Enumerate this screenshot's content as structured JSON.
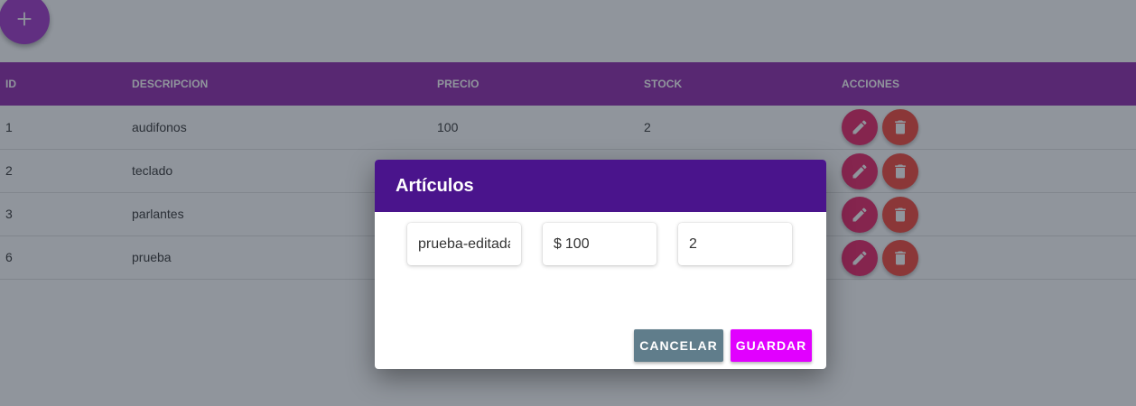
{
  "fab": {
    "icon": "plus-icon"
  },
  "table": {
    "headers": {
      "id": "ID",
      "descripcion": "DESCRIPCION",
      "precio": "PRECIO",
      "stock": "STOCK",
      "acciones": "ACCIONES"
    },
    "rows": [
      {
        "id": "1",
        "descripcion": "audifonos",
        "precio": "100",
        "stock": "2"
      },
      {
        "id": "2",
        "descripcion": "teclado",
        "precio": "",
        "stock": ""
      },
      {
        "id": "3",
        "descripcion": "parlantes",
        "precio": "",
        "stock": ""
      },
      {
        "id": "6",
        "descripcion": "prueba",
        "precio": "",
        "stock": ""
      }
    ],
    "action_icons": {
      "edit": "pencil-icon",
      "delete": "trash-icon"
    },
    "colors": {
      "header": "#8e24aa",
      "edit": "#e91e63",
      "delete": "#f44336"
    }
  },
  "dialog": {
    "title": "Artículos",
    "fields": {
      "descripcion": "prueba-editada",
      "precio_prefix": "$",
      "precio": "100",
      "stock": "2"
    },
    "buttons": {
      "cancel": "CANCELAR",
      "save": "GUARDAR"
    },
    "colors": {
      "header": "#4a148c",
      "cancel": "#607d8b",
      "save": "#e100ff"
    }
  }
}
